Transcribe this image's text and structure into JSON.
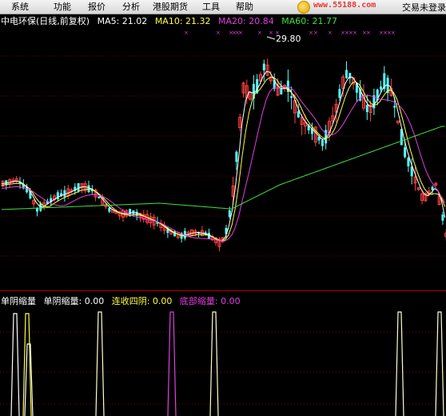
{
  "menu": [
    "系统",
    "功能",
    "报价",
    "分析",
    "港股期货",
    "工具",
    "帮助"
  ],
  "watermark": "www.55188.com",
  "trade_status": "交易未登录",
  "stock": {
    "title": "中电环保(日线,前复权)",
    "ma5": "MA5: 21.02",
    "ma10": "MA10: 21.32",
    "ma20": "MA20: 20.84",
    "ma60": "MA60: 21.77",
    "peak_label": "29.80"
  },
  "indicator": {
    "name": "单阴缩量",
    "v1": "单阴缩量: 0.00",
    "v2": "连收四阴: 0.00",
    "v3": "底部缩量: 0.00"
  },
  "colors": {
    "up": "#ff4040",
    "down": "#54ffff",
    "ma5": "#ffffff",
    "ma10": "#ffff40",
    "ma20": "#e040e0",
    "ma60": "#40e040",
    "grid": "#7a0000"
  }
}
